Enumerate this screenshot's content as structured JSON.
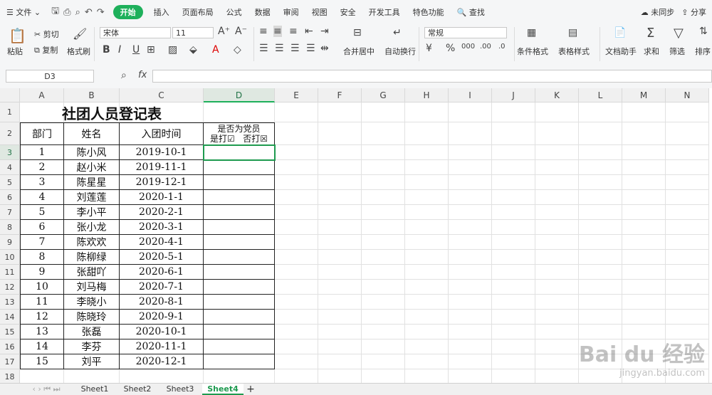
{
  "menu": {
    "file": "文件",
    "tabs": [
      "开始",
      "插入",
      "页面布局",
      "公式",
      "数据",
      "审阅",
      "视图",
      "安全",
      "开发工具",
      "特色功能"
    ],
    "search": "查找",
    "sync": "未同步",
    "share": "分享"
  },
  "ribbon": {
    "paste": "粘贴",
    "cut": "剪切",
    "copy": "复制",
    "format_painter": "格式刷",
    "font": "宋体",
    "font_size": "11",
    "merge_center": "合并居中",
    "wrap": "自动换行",
    "number_format": "常规",
    "cond_format": "条件格式",
    "table_style": "表格样式",
    "doc_helper": "文档助手",
    "sum": "求和",
    "filter": "筛选",
    "sort": "排序"
  },
  "formula_bar": {
    "name_box": "D3",
    "fx": "fx"
  },
  "columns": [
    "A",
    "B",
    "C",
    "D",
    "E",
    "F",
    "G",
    "H",
    "I",
    "J",
    "K",
    "L",
    "M",
    "N"
  ],
  "rows": [
    "1",
    "2",
    "3",
    "4",
    "5",
    "6",
    "7",
    "8",
    "9",
    "10",
    "11",
    "12",
    "13",
    "14",
    "15",
    "16",
    "17",
    "18"
  ],
  "sheet": {
    "title": "社团人员登记表",
    "headers": [
      "部门",
      "姓名",
      "入团时间"
    ],
    "d_header_line1": "是否为党员",
    "d_header_line2": "是打☑   否打☒",
    "data": [
      [
        "1",
        "陈小风",
        "2019-10-1"
      ],
      [
        "2",
        "赵小米",
        "2019-11-1"
      ],
      [
        "3",
        "陈星星",
        "2019-12-1"
      ],
      [
        "4",
        "刘莲莲",
        "2020-1-1"
      ],
      [
        "5",
        "李小平",
        "2020-2-1"
      ],
      [
        "6",
        "张小龙",
        "2020-3-1"
      ],
      [
        "7",
        "陈欢欢",
        "2020-4-1"
      ],
      [
        "8",
        "陈柳绿",
        "2020-5-1"
      ],
      [
        "9",
        "张甜吖",
        "2020-6-1"
      ],
      [
        "10",
        "刘马梅",
        "2020-7-1"
      ],
      [
        "11",
        "李晓小",
        "2020-8-1"
      ],
      [
        "12",
        "陈晓玲",
        "2020-9-1"
      ],
      [
        "13",
        "张磊",
        "2020-10-1"
      ],
      [
        "14",
        "李芬",
        "2020-11-1"
      ],
      [
        "15",
        "刘平",
        "2020-12-1"
      ]
    ]
  },
  "sheet_tabs": [
    "Sheet1",
    "Sheet2",
    "Sheet3",
    "Sheet4"
  ],
  "active_sheet": "Sheet4",
  "add_sheet": "+",
  "watermark": {
    "brand": "Bai du 经验",
    "url": "jingyan.baidu.com"
  },
  "colors": {
    "accent": "#1eb05b",
    "select": "#1e9a4f"
  }
}
